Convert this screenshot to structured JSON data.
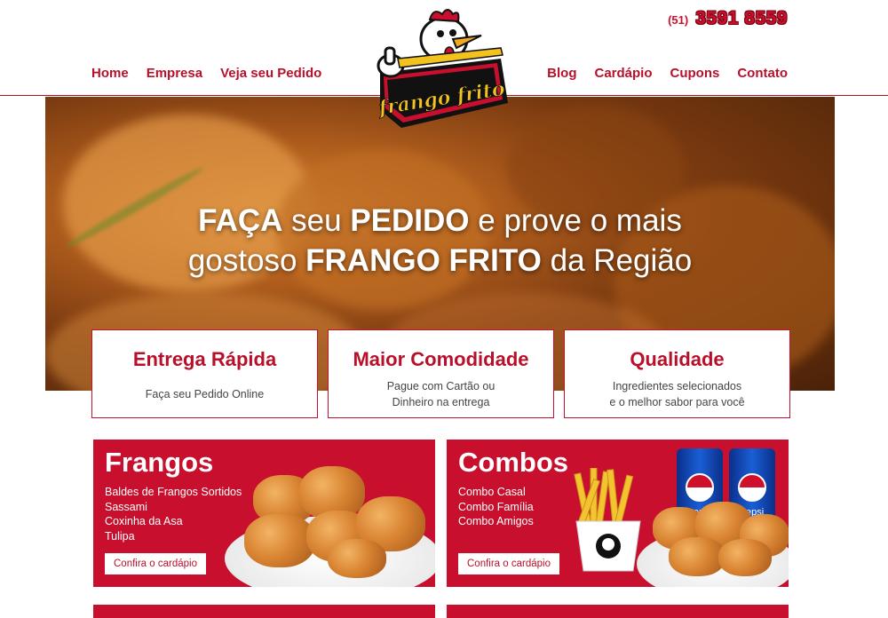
{
  "brand": {
    "logo_text": "frango frito",
    "colors": {
      "primary": "#c8102e",
      "text": "#444444",
      "white": "#ffffff"
    }
  },
  "header": {
    "phone_ddd": "(51)",
    "phone_number": "3591 8559",
    "nav_left": [
      "Home",
      "Empresa",
      "Veja seu Pedido"
    ],
    "nav_right": [
      "Blog",
      "Cardápio",
      "Cupons",
      "Contato"
    ]
  },
  "hero": {
    "line1_a": "FAÇA",
    "line1_b": " seu ",
    "line1_c": "PEDIDO",
    "line1_d": " e prove o mais",
    "line2_a": "gostoso ",
    "line2_b": "FRANGO FRITO",
    "line2_c": " da Região"
  },
  "features": [
    {
      "title": "Entrega Rápida",
      "line1": "Faça seu Pedido Online",
      "line2": ""
    },
    {
      "title": "Maior Comodidade",
      "line1": "Pague com Cartão ou",
      "line2": "Dinheiro na entrega"
    },
    {
      "title": "Qualidade",
      "line1": "Ingredientes selecionados",
      "line2": "e o melhor sabor para você"
    }
  ],
  "panels": [
    {
      "title": "Frangos",
      "items": [
        "Baldes de Frangos Sortidos",
        "Sassami",
        "Coxinha da Asa",
        "Tulipa"
      ],
      "button": "Confira o cardápio"
    },
    {
      "title": "Combos",
      "items": [
        "Combo Casal",
        "Combo Família",
        "Combo Amigos"
      ],
      "button": "Confira o cardápio"
    }
  ],
  "products": {
    "can_brand": "pepsi"
  }
}
